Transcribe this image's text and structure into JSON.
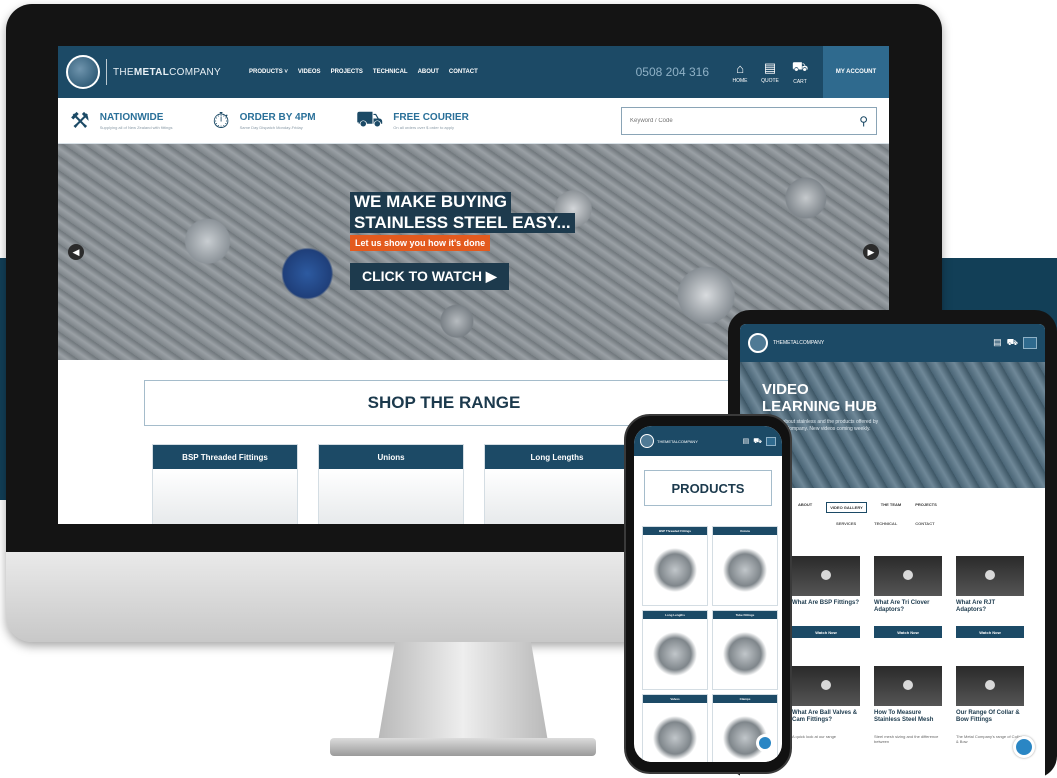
{
  "desktop": {
    "logo_text_prefix": "THE",
    "logo_text_bold": "METAL",
    "logo_text_suffix": "COMPANY",
    "menu": [
      "PRODUCTS ˅",
      "VIDEOS",
      "PROJECTS",
      "TECHNICAL",
      "ABOUT",
      "CONTACT"
    ],
    "phone": "0508 204 316",
    "nav_icons": [
      {
        "icon": "home-icon",
        "glyph": "⌂",
        "label": "HOME"
      },
      {
        "icon": "quote-icon",
        "glyph": "▤",
        "label": "QUOTE"
      },
      {
        "icon": "cart-icon",
        "glyph": "⛟",
        "label": "CART"
      }
    ],
    "account_label": "MY ACCOUNT",
    "info": [
      {
        "icon": "wrench-icon",
        "glyph": "⚒",
        "title": "NATIONWIDE",
        "subtitle": "Supplying all of New Zealand with fittings"
      },
      {
        "icon": "stopwatch-icon",
        "glyph": "⏱",
        "title": "ORDER BY 4PM",
        "subtitle": "Same Day Dispatch Monday-Friday"
      },
      {
        "icon": "truck-icon",
        "glyph": "⛟",
        "title": "FREE COURIER",
        "subtitle": "On all orders over $ order to apply"
      }
    ],
    "search_placeholder": "Keyword / Code",
    "hero": {
      "line1": "WE MAKE BUYING",
      "line2": "STAINLESS STEEL EASY...",
      "sub": "Let us show you how it's done",
      "cta": "CLICK TO WATCH ▶"
    },
    "shop_title": "SHOP THE RANGE",
    "categories": [
      "BSP Threaded Fittings",
      "Unions",
      "Long Lengths"
    ]
  },
  "tablet": {
    "logo": "THEMETALCOMPANY",
    "hero_title_1": "VIDEO",
    "hero_title_2": "LEARNING HUB",
    "hero_desc": "Learn all about stainless and the products offered by The Metal Company. New videos coming weekly.",
    "tabs_row1": [
      "ABOUT",
      "VIDEO GALLERY",
      "THE TEAM",
      "PROJECTS"
    ],
    "tabs_row2": [
      "SERVICES",
      "TECHNICAL",
      "CONTACT"
    ],
    "videos": [
      {
        "title": "What Are BSP Fittings?",
        "button": "Watch Now"
      },
      {
        "title": "What Are Tri Clover Adaptors?",
        "button": "Watch Now"
      },
      {
        "title": "What Are RJT Adaptors?",
        "button": "Watch Now"
      },
      {
        "title": "What Are Ball Valves & Cam Fittings?",
        "button": "",
        "desc": "A quick look at our range"
      },
      {
        "title": "How To Measure Stainless Steel Mesh",
        "button": "",
        "desc": "Steel mesh sizing and the difference between"
      },
      {
        "title": "Our Range Of Collar & Bow Fittings",
        "button": "",
        "desc": "The Metal Company's range of Collar & Bow"
      }
    ]
  },
  "phone": {
    "logo": "THEMETALCOMPANY",
    "title": "PRODUCTS",
    "cards": [
      "BSP Threaded Fittings",
      "Unions",
      "Long Lengths",
      "Tube Fittings",
      "Valves",
      "Clamps"
    ]
  },
  "colors": {
    "brand_navy": "#1c4a66",
    "accent_orange": "#e35a1e",
    "backdrop": "#123f57"
  }
}
